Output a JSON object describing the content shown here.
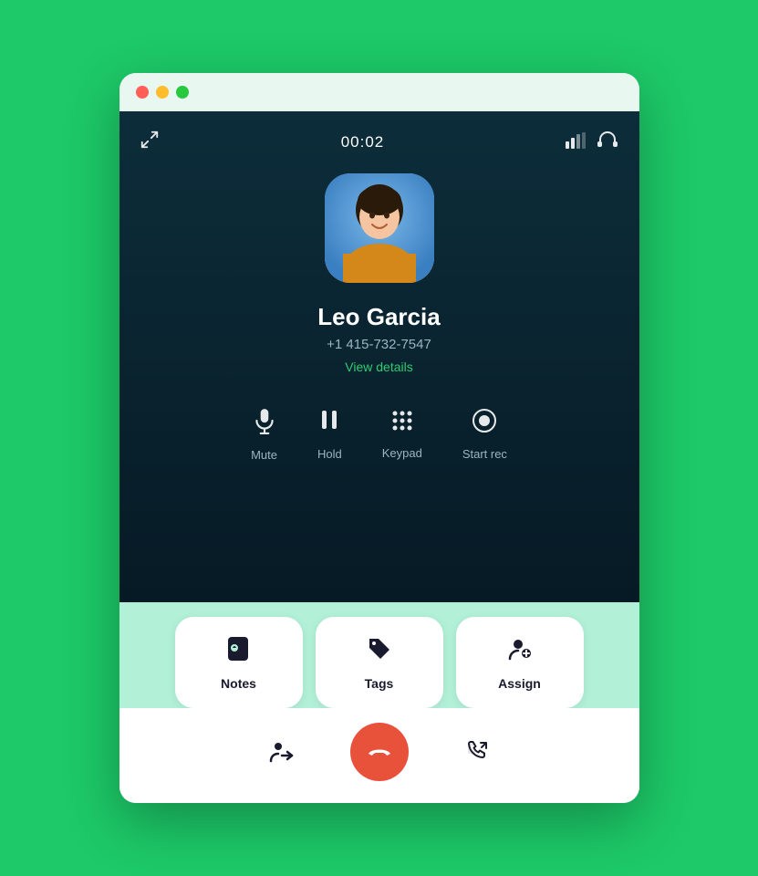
{
  "window": {
    "dots": [
      "red",
      "yellow",
      "green"
    ]
  },
  "call": {
    "timer": "00:02",
    "caller_name": "Leo Garcia",
    "caller_number": "+1 415-732-7547",
    "view_details_label": "View details"
  },
  "controls": [
    {
      "id": "mute",
      "label": "Mute",
      "icon": "mic"
    },
    {
      "id": "hold",
      "label": "Hold",
      "icon": "pause"
    },
    {
      "id": "keypad",
      "label": "Keypad",
      "icon": "grid"
    },
    {
      "id": "start-rec",
      "label": "Start rec",
      "icon": "record"
    }
  ],
  "actions": [
    {
      "id": "notes",
      "label": "Notes",
      "icon": "notes"
    },
    {
      "id": "tags",
      "label": "Tags",
      "icon": "tag"
    },
    {
      "id": "assign",
      "label": "Assign",
      "icon": "assign"
    }
  ],
  "footer_controls": [
    {
      "id": "transfer",
      "icon": "transfer"
    },
    {
      "id": "end-call",
      "icon": "end-call"
    },
    {
      "id": "external-call",
      "icon": "external-call"
    }
  ],
  "colors": {
    "green_bg": "#1dc968",
    "panel_bg": "#0d2d3a",
    "accent_green": "#2ecc71",
    "end_call_red": "#e8523a"
  }
}
